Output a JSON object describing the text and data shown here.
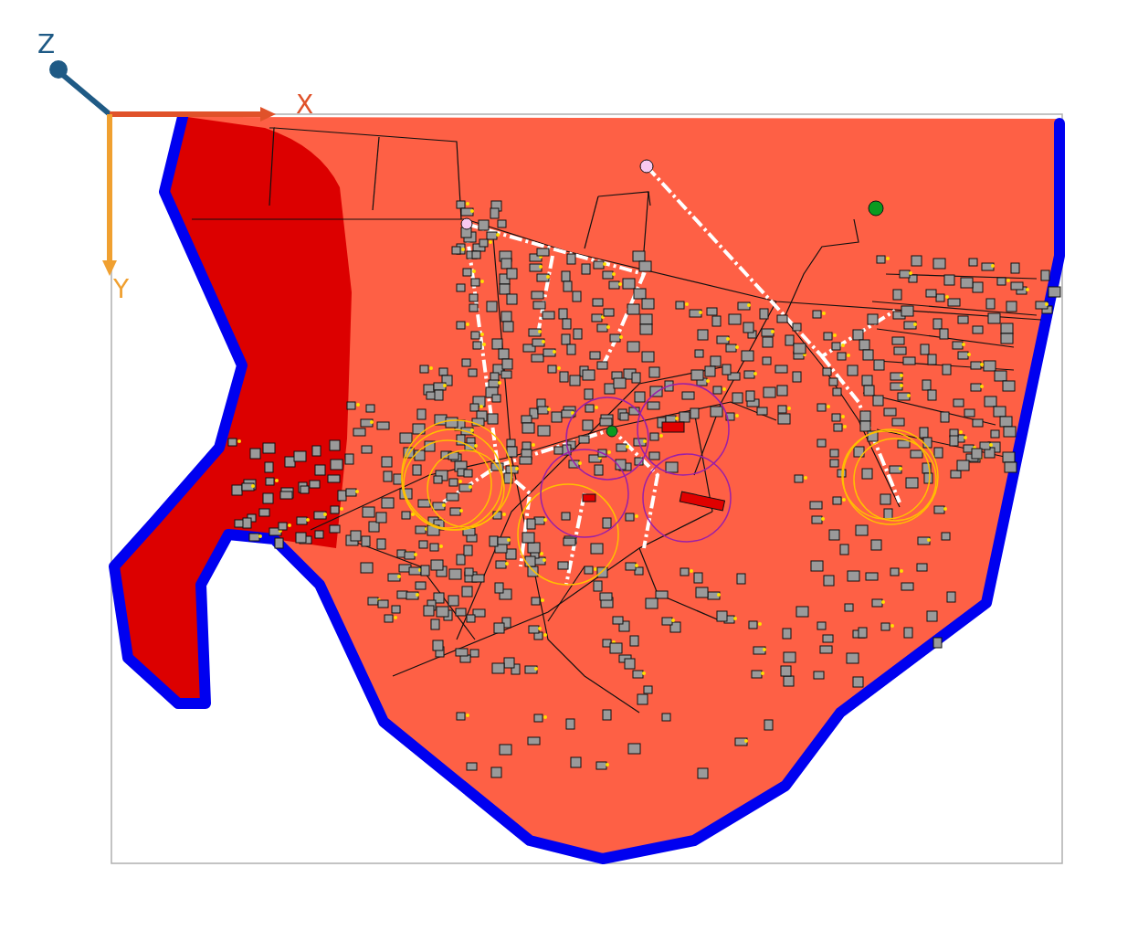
{
  "axes": [
    {
      "label": "Z",
      "kind": "z"
    },
    {
      "label": "X",
      "kind": "x"
    },
    {
      "label": "Y",
      "kind": "y"
    }
  ]
}
